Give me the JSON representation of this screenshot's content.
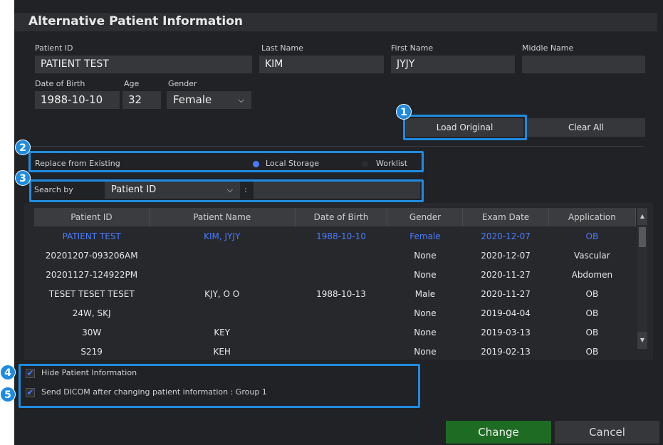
{
  "dialog_title": "Alternative Patient Information",
  "fields": {
    "patient_id_label": "Patient ID",
    "patient_id_value": "PATIENT TEST",
    "last_name_label": "Last Name",
    "last_name_value": "KIM",
    "first_name_label": "First Name",
    "first_name_value": "JYJY",
    "middle_name_label": "Middle Name",
    "middle_name_value": "",
    "dob_label": "Date of Birth",
    "dob_value": "1988-10-10",
    "age_label": "Age",
    "age_value": "32",
    "gender_label": "Gender",
    "gender_value": "Female"
  },
  "buttons": {
    "load_original": "Load Original",
    "clear_all": "Clear All",
    "change": "Change",
    "cancel": "Cancel"
  },
  "replace": {
    "label": "Replace from Existing",
    "local_storage": "Local Storage",
    "worklist": "Worklist"
  },
  "search": {
    "label": "Search by",
    "selected": "Patient ID",
    "colon": ":",
    "value": ""
  },
  "table": {
    "headers": [
      "Patient ID",
      "Patient Name",
      "Date of Birth",
      "Gender",
      "Exam Date",
      "Application"
    ],
    "rows": [
      [
        "PATIENT TEST",
        "KIM, JYJY",
        "1988-10-10",
        "Female",
        "2020-12-07",
        "OB"
      ],
      [
        "20201207-093206AM",
        "",
        "",
        "None",
        "2020-12-07",
        "Vascular"
      ],
      [
        "20201127-124922PM",
        "",
        "",
        "None",
        "2020-11-27",
        "Abdomen"
      ],
      [
        "TESET TESET TESET",
        "KJY, O O",
        "1988-10-13",
        "Male",
        "2020-11-27",
        "OB"
      ],
      [
        "24W, SKJ",
        "",
        "",
        "None",
        "2019-04-04",
        "OB"
      ],
      [
        "30W",
        "KEY",
        "",
        "None",
        "2019-03-13",
        "OB"
      ],
      [
        "S219",
        "KEH",
        "",
        "None",
        "2019-02-13",
        "OB"
      ]
    ]
  },
  "options": {
    "hide_patient_info": "Hide Patient Information",
    "send_dicom": "Send DICOM after changing patient information : Group 1"
  },
  "badges": [
    "1",
    "2",
    "3",
    "4",
    "5"
  ],
  "colors": {
    "accent": "#1f8be0",
    "change_button": "#1e6b23",
    "selected_row_text": "#4a7bff",
    "dialog_bg": "#202226"
  }
}
